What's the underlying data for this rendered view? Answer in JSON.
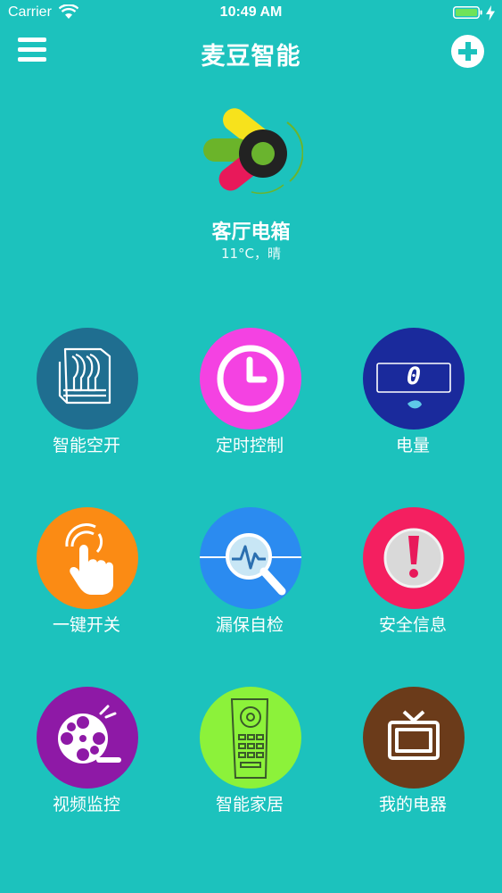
{
  "status_bar": {
    "carrier": "Carrier",
    "time": "10:49 AM"
  },
  "nav": {
    "title": "麦豆智能"
  },
  "device": {
    "name": "客厅电箱",
    "weather": "11°C，晴"
  },
  "grid": [
    {
      "label": "智能空开",
      "icon": "breaker-icon",
      "color": "#1f6e90"
    },
    {
      "label": "定时控制",
      "icon": "clock-icon",
      "color": "#f442e2"
    },
    {
      "label": "电量",
      "icon": "meter-icon",
      "color": "#1a2a9c",
      "meter_value": "0"
    },
    {
      "label": "一键开关",
      "icon": "touch-icon",
      "color": "#fb8b14"
    },
    {
      "label": "漏保自检",
      "icon": "magnifier-icon",
      "color": "#2b8bf0"
    },
    {
      "label": "安全信息",
      "icon": "warning-icon",
      "color": "#f41f60"
    },
    {
      "label": "视频监控",
      "icon": "film-reel-icon",
      "color": "#8e19a6"
    },
    {
      "label": "智能家居",
      "icon": "remote-control-icon",
      "color": "#8cf23a"
    },
    {
      "label": "我的电器",
      "icon": "tv-icon",
      "color": "#6b3b1a"
    }
  ]
}
